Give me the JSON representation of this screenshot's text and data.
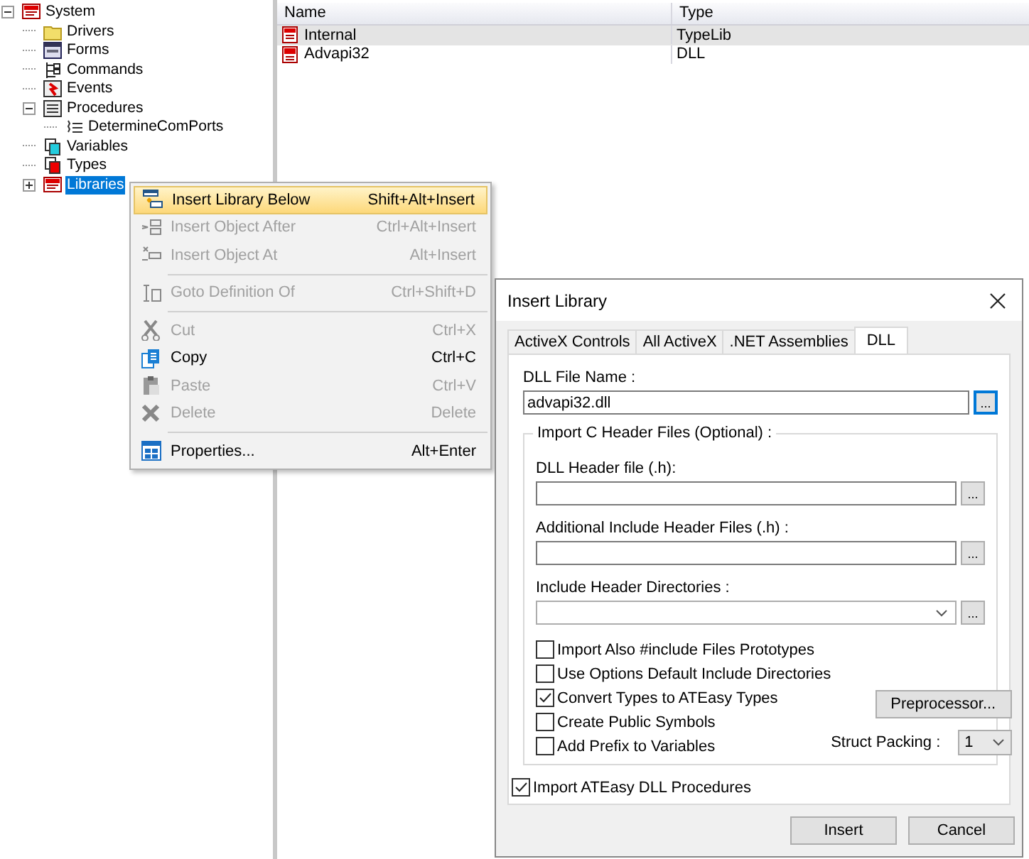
{
  "tree": {
    "items": [
      {
        "label": "System",
        "kind": "system",
        "expanded": true,
        "selected": false,
        "children": [
          {
            "label": "Drivers",
            "kind": "folder",
            "selected": false
          },
          {
            "label": "Forms",
            "kind": "forms",
            "selected": false
          },
          {
            "label": "Commands",
            "kind": "commands",
            "selected": false
          },
          {
            "label": "Events",
            "kind": "events",
            "selected": false
          },
          {
            "label": "Procedures",
            "kind": "procedures",
            "expanded": true,
            "selected": false,
            "children": [
              {
                "label": "DetermineComPorts",
                "kind": "procedure",
                "selected": false
              }
            ]
          },
          {
            "label": "Variables",
            "kind": "variables",
            "selected": false
          },
          {
            "label": "Types",
            "kind": "types",
            "selected": false
          },
          {
            "label": "Libraries",
            "kind": "system",
            "expanded": false,
            "selected": true
          }
        ]
      }
    ]
  },
  "list": {
    "columns": [
      "Name",
      "Type"
    ],
    "rows": [
      {
        "name": "Internal",
        "type": "TypeLib",
        "kind": "com",
        "selected": true
      },
      {
        "name": "Advapi32",
        "type": "DLL",
        "kind": "dll",
        "selected": false
      }
    ]
  },
  "context_menu": {
    "items": [
      {
        "kind": "item",
        "label": "Insert Library Below",
        "shortcut": "Shift+Alt+Insert",
        "disabled": false,
        "selected": true
      },
      {
        "kind": "item",
        "label": "Insert Object After",
        "shortcut": "Ctrl+Alt+Insert",
        "disabled": true,
        "selected": false
      },
      {
        "kind": "item",
        "label": "Insert Object At",
        "shortcut": "Alt+Insert",
        "disabled": true,
        "selected": false
      },
      {
        "kind": "separator"
      },
      {
        "kind": "item",
        "label": "Goto Definition Of",
        "shortcut": "Ctrl+Shift+D",
        "disabled": true,
        "selected": false
      },
      {
        "kind": "separator"
      },
      {
        "kind": "item",
        "label": "Cut",
        "shortcut": "Ctrl+X",
        "disabled": true,
        "selected": false
      },
      {
        "kind": "item",
        "label": "Copy",
        "shortcut": "Ctrl+C",
        "disabled": false,
        "selected": false
      },
      {
        "kind": "item",
        "label": "Paste",
        "shortcut": "Ctrl+V",
        "disabled": true,
        "selected": false
      },
      {
        "kind": "item",
        "label": "Delete",
        "shortcut": "Delete",
        "disabled": true,
        "selected": false
      },
      {
        "kind": "separator"
      },
      {
        "kind": "item",
        "label": "Properties...",
        "shortcut": "Alt+Enter",
        "disabled": false,
        "selected": false
      }
    ]
  },
  "dialog": {
    "title": "Insert Library",
    "tabs": [
      {
        "label": "ActiveX Controls",
        "selected": false
      },
      {
        "label": "All ActiveX",
        "selected": false
      },
      {
        "label": ".NET Assemblies",
        "selected": false
      },
      {
        "label": "DLL",
        "selected": true
      }
    ],
    "file": {
      "label": "DLL File Name :",
      "value": "advapi32.dll",
      "browse": "..."
    },
    "group_title": "Import C Header Files (Optional) :",
    "fields": [
      {
        "kind": "text",
        "label": "DLL Header file (.h):",
        "browse": "..."
      },
      {
        "kind": "text",
        "label": "Additional Include Header Files (.h) :",
        "browse": "..."
      },
      {
        "kind": "combo",
        "label": "Include Header Directories :",
        "browse": "..."
      }
    ],
    "options": [
      {
        "label": "Import Also #include Files Prototypes",
        "checked": false
      },
      {
        "label": "Use Options Default Include Directories",
        "checked": false
      },
      {
        "label": "Convert Types to ATEasy Types",
        "checked": true
      },
      {
        "label": "Create Public Symbols",
        "checked": false
      },
      {
        "label": "Add Prefix to Variables",
        "checked": false
      }
    ],
    "preprocessor": "Preprocessor...",
    "struct_packing": {
      "label": "Struct Packing :",
      "value": "1"
    },
    "import_procedures": {
      "label": "Import ATEasy DLL Procedures",
      "checked": true
    },
    "buttons": [
      "Insert",
      "Cancel"
    ]
  }
}
